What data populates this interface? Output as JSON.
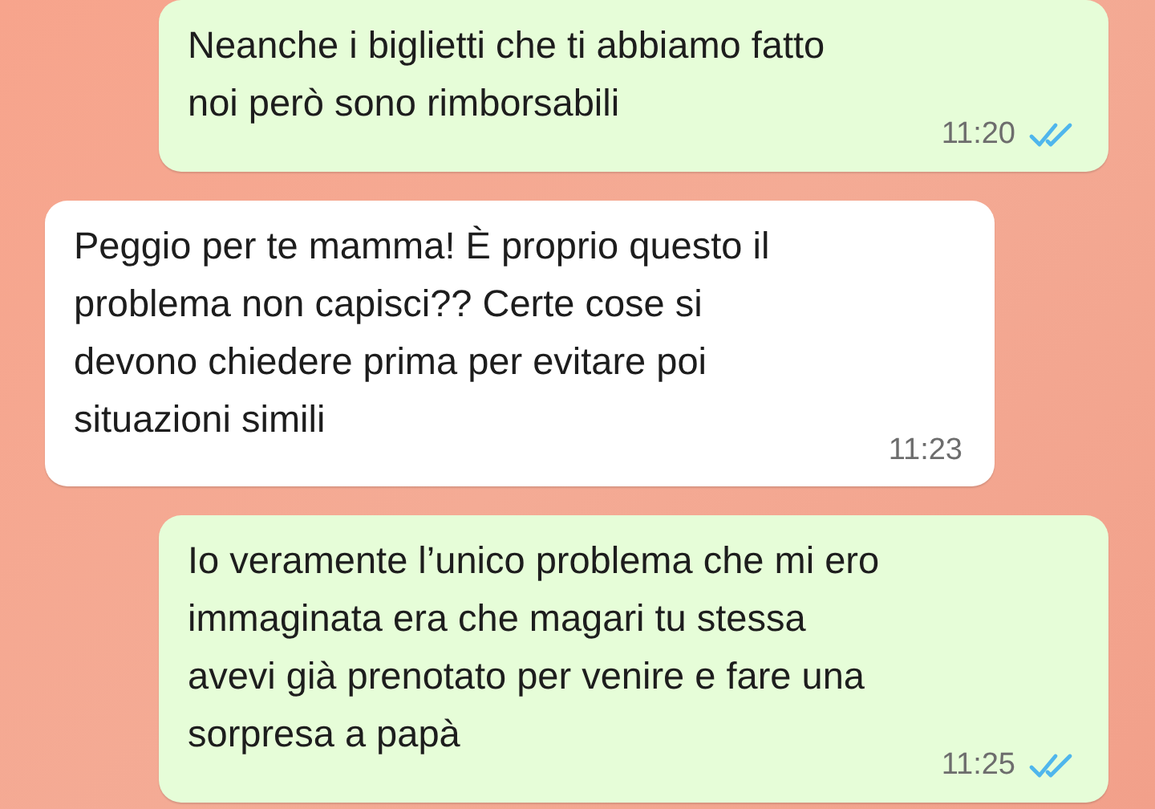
{
  "messages": [
    {
      "kind": "sent",
      "text": "Neanche i biglietti che ti abbiamo fatto\nnoi però sono rimborsabili",
      "time": "11:20",
      "read": true
    },
    {
      "kind": "received",
      "text": "Peggio per te mamma! È proprio questo il\nproblema non capisci?? Certe cose si\ndevono chiedere prima per evitare poi\nsituazioni simili",
      "time": "11:23"
    },
    {
      "kind": "sent",
      "text": "Io veramente l’unico problema che mi ero\nimmaginata era che magari tu stessa\navevi già prenotato per venire e fare una\nsorpresa a papà",
      "time": "11:25",
      "read": true
    }
  ]
}
